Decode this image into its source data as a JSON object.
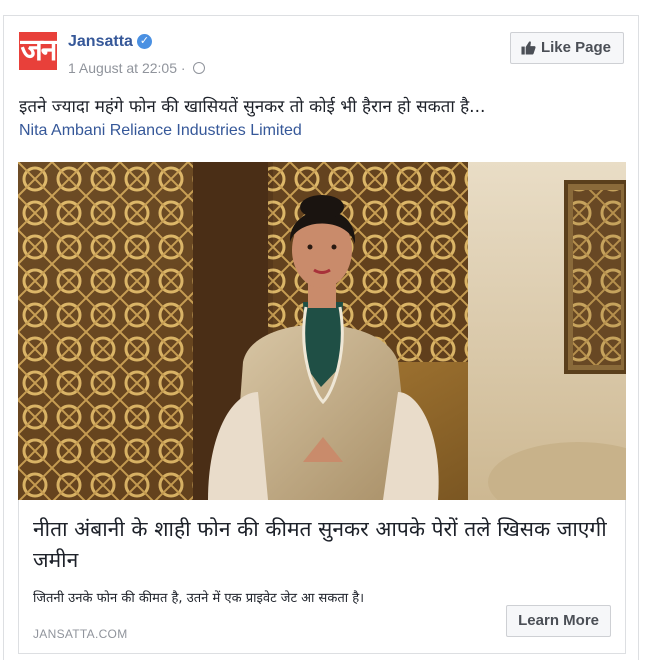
{
  "post": {
    "page_name": "Jansatta",
    "logo_text": "जन",
    "timestamp": "1 August at 22:05",
    "like_button": "Like Page",
    "text": "इतने ज्यादा महंगे फोन की खासियतें सुनकर तो कोई भी हैरान हो सकता है...",
    "tagged_link": "Nita Ambani Reliance Industries Limited"
  },
  "link_preview": {
    "headline": "नीता अंबानी के शाही फोन की कीमत सुनकर आपके पेरों तले खिसक जाएगी जमीन",
    "description": "जितनी उनके फोन की कीमत है, उतने में एक प्राइवेट जेट आ सकता है।",
    "domain": "JANSATTA.COM",
    "cta_button": "Learn More"
  },
  "icons": {
    "verified": "verified-badge-icon",
    "privacy": "globe-icon",
    "like": "thumbs-up-icon"
  },
  "colors": {
    "brand_logo": "#e8403a",
    "link_blue": "#365899",
    "verified_blue": "#4a90e2"
  }
}
